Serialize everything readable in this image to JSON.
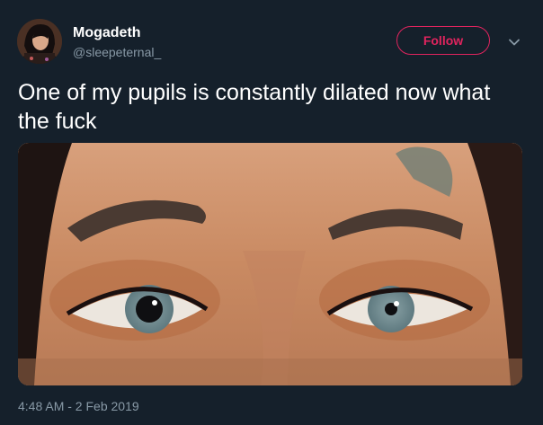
{
  "user": {
    "display_name": "Mogadeth",
    "handle": "@sleepeternal_"
  },
  "follow_button": {
    "label": "Follow"
  },
  "tweet": {
    "text": "One of my pupils is constantly dilated now what the fuck",
    "timestamp": "4:48 AM - 2 Feb 2019"
  },
  "icons": {
    "caret": "chevron-down-icon"
  },
  "colors": {
    "background": "#15202b",
    "text_primary": "#ffffff",
    "text_secondary": "#8899a6",
    "follow_accent": "#e0245e"
  }
}
